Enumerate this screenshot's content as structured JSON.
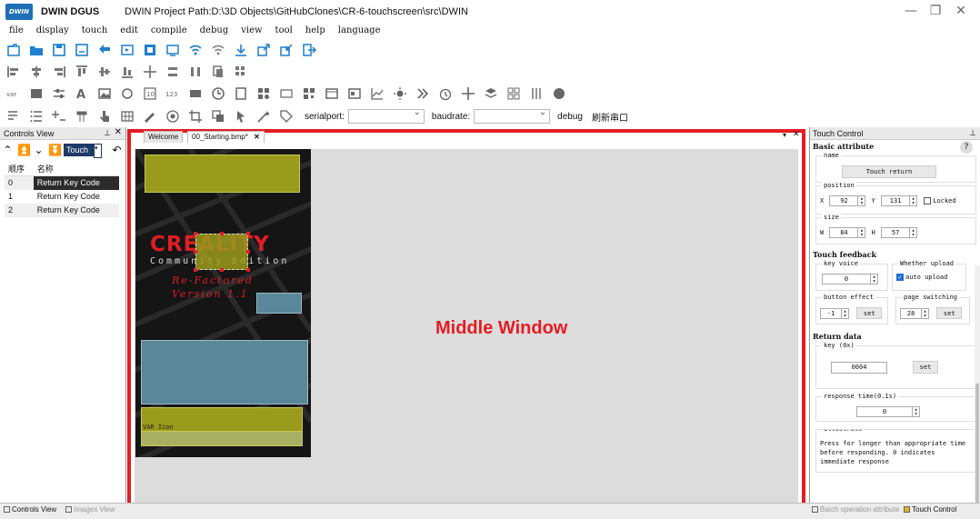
{
  "titlebar": {
    "logo_text": "DWIN",
    "app_name": "DWIN DGUS",
    "project_path": "DWIN Project Path:D:\\3D Objects\\GitHubClones\\CR-6-touchscreen\\src\\DWIN",
    "minimize": "—",
    "maximize": "❐",
    "close": "✕"
  },
  "menu": [
    "file",
    "display",
    "touch",
    "edit",
    "compile",
    "debug",
    "view",
    "tool",
    "help",
    "language"
  ],
  "toolbar4": {
    "serialport_label": "serialport:",
    "baudrate_label": "baudrate:",
    "debug_label": "debug",
    "refresh_port_label": "刷新串口"
  },
  "controls_view": {
    "title": "Controls View",
    "filter_value": "Touch",
    "columns": [
      "顺序",
      "名称"
    ],
    "rows": [
      {
        "index": "0",
        "name": "Return Key Code"
      },
      {
        "index": "1",
        "name": "Return Key Code"
      },
      {
        "index": "2",
        "name": "Return Key Code"
      }
    ]
  },
  "tabs": {
    "welcome": "Welcome",
    "file": "00_Starting.bmp*"
  },
  "middle_window": {
    "label": "Middle Window",
    "screen": {
      "logo": "CREALITY",
      "edition": "Community Edition",
      "refactored": "Re-Factored",
      "version": "Version 1.1",
      "var_icon": "VAR Icon"
    }
  },
  "touch_control": {
    "title": "Touch Control",
    "basic_attribute": "Basic attribute",
    "help": "?",
    "name_label": "name",
    "name_value": "Touch return",
    "position_label": "position",
    "x_label": "X",
    "x_value": "92",
    "y_label": "Y",
    "y_value": "131",
    "locked_label": "Locked",
    "size_label": "size",
    "w_label": "W",
    "w_value": "84",
    "h_label": "H",
    "h_value": "57",
    "touch_feedback": "Touch feedback",
    "key_voice_label": "key voice",
    "key_voice_value": "0",
    "whether_upload_label": "Whether upload",
    "auto_upload_label": "auto upload",
    "button_effect_label": "button effect",
    "button_effect_value": "-1",
    "page_switching_label": "page switching",
    "page_switching_value": "28",
    "set_label": "set",
    "return_data": "Return data",
    "key_label": "key (0x)",
    "key_value": "0004",
    "response_time_label": "response time(0.1s)",
    "response_time_value": "0",
    "illustrate_label": "illustrate",
    "illustrate_text": "Press for longer than appropriate time before responding. 0 indicates immediate response"
  },
  "bottom_tabs": {
    "controls_view": "Controls View",
    "images_view": "Images View",
    "batch": "Batch operation attribute",
    "touch_control": "Touch Control"
  },
  "colors": {
    "highlight_red": "#e51c24",
    "yellow_box": "#9a9a1c",
    "blue_box": "#5a8799"
  }
}
